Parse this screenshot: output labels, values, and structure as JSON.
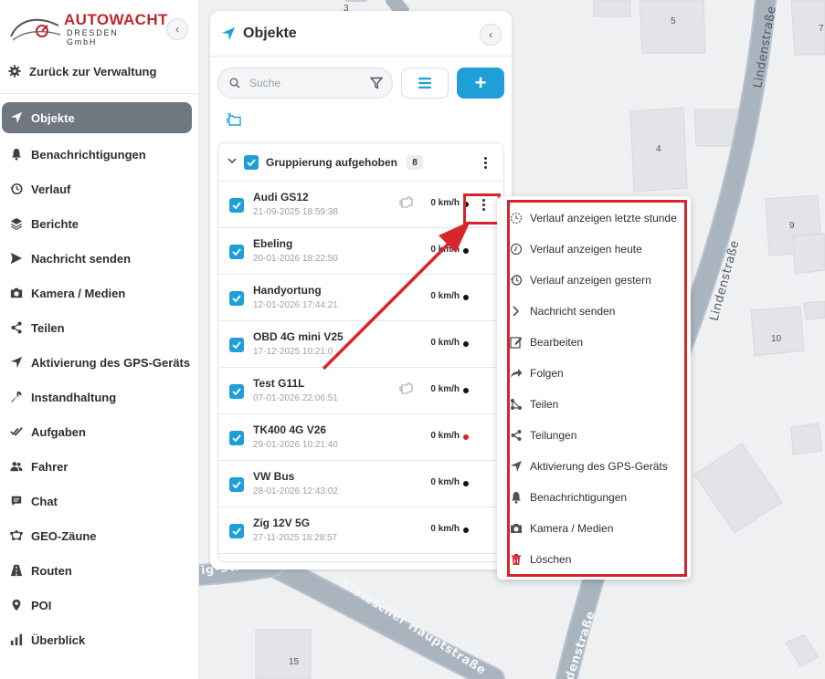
{
  "brand": {
    "name_top": "AUTOWACHT",
    "name_bottom": "DRESDEN GmbH"
  },
  "sidebar": {
    "back_label": "Zurück zur Verwaltung",
    "items": [
      {
        "label": "Objekte",
        "icon": "navigation-arrow-icon",
        "active": true
      },
      {
        "label": "Benachrichtigungen",
        "icon": "bell-icon"
      },
      {
        "label": "Verlauf",
        "icon": "history-icon"
      },
      {
        "label": "Berichte",
        "icon": "layers-icon"
      },
      {
        "label": "Nachricht senden",
        "icon": "send-icon"
      },
      {
        "label": "Kamera / Medien",
        "icon": "camera-icon"
      },
      {
        "label": "Teilen",
        "icon": "share-icon"
      },
      {
        "label": "Aktivierung des GPS-Geräts",
        "icon": "navigation-arrow-icon"
      },
      {
        "label": "Instandhaltung",
        "icon": "wrench-icon"
      },
      {
        "label": "Aufgaben",
        "icon": "double-check-icon"
      },
      {
        "label": "Fahrer",
        "icon": "users-icon"
      },
      {
        "label": "Chat",
        "icon": "chat-icon"
      },
      {
        "label": "GEO-Zäune",
        "icon": "geofence-icon"
      },
      {
        "label": "Routen",
        "icon": "road-icon"
      },
      {
        "label": "POI",
        "icon": "pin-icon"
      },
      {
        "label": "Überblick",
        "icon": "bar-chart-icon"
      }
    ]
  },
  "panel": {
    "title": "Objekte",
    "search_placeholder": "Suche",
    "add_label": "+",
    "group": {
      "name": "Gruppierung aufgehoben",
      "count": "8"
    },
    "objects": [
      {
        "name": "Audi GS12",
        "time": "21-09-2025 18:59:38",
        "speed": "0 km/h",
        "status_color": "#111111",
        "engine_icon": true
      },
      {
        "name": "Ebeling",
        "time": "20-01-2026 18:22:50",
        "speed": "0 km/h",
        "status_color": "#111111",
        "engine_icon": false
      },
      {
        "name": "Handyortung",
        "time": "12-01-2026 17:44:21",
        "speed": "0 km/h",
        "status_color": "#111111",
        "engine_icon": false
      },
      {
        "name": "OBD 4G mini V25",
        "time": "17-12-2025 10:21:0",
        "speed": "0 km/h",
        "status_color": "#111111",
        "engine_icon": false
      },
      {
        "name": "Test G11L",
        "time": "07-01-2026 22:06:51",
        "speed": "0 km/h",
        "status_color": "#111111",
        "engine_icon": true
      },
      {
        "name": "TK400 4G V26",
        "time": "29-01-2026 10:21:40",
        "speed": "0 km/h",
        "status_color": "#d7262b",
        "engine_icon": false
      },
      {
        "name": "VW Bus",
        "time": "28-01-2026 12:43:02",
        "speed": "0 km/h",
        "status_color": "#111111",
        "engine_icon": false
      },
      {
        "name": "Zig 12V 5G",
        "time": "27-11-2025 18:28:57",
        "speed": "0 km/h",
        "status_color": "#111111",
        "engine_icon": false
      }
    ]
  },
  "context_menu": {
    "items": [
      {
        "label": "Verlauf anzeigen letzte stunde",
        "icon": "clock-dotted-icon"
      },
      {
        "label": "Verlauf anzeigen heute",
        "icon": "clock-icon"
      },
      {
        "label": "Verlauf anzeigen gestern",
        "icon": "history-icon"
      },
      {
        "label": "Nachricht senden",
        "icon": "chevron-right-icon"
      },
      {
        "label": "Bearbeiten",
        "icon": "edit-icon"
      },
      {
        "label": "Folgen",
        "icon": "share-arrow-icon"
      },
      {
        "label": "Teilen",
        "icon": "share-nodes-icon"
      },
      {
        "label": "Teilungen",
        "icon": "share-icon"
      },
      {
        "label": "Aktivierung des GPS-Geräts",
        "icon": "navigation-arrow-icon"
      },
      {
        "label": "Benachrichtigungen",
        "icon": "bell-icon"
      },
      {
        "label": "Kamera / Medien",
        "icon": "camera-icon"
      },
      {
        "label": "Löschen",
        "icon": "trash-icon"
      }
    ]
  },
  "map": {
    "streets": [
      "Lindenstraße",
      "Lindenstraße",
      "Klotzscher Hauptstraße",
      "ig-Str",
      "denstraße"
    ],
    "house_numbers": [
      "3",
      "5",
      "4",
      "9",
      "10",
      "15",
      "7"
    ]
  },
  "colors": {
    "accent": "#1f9fd8",
    "annotation_red": "#d7262b",
    "active_nav": "#6f7780"
  }
}
